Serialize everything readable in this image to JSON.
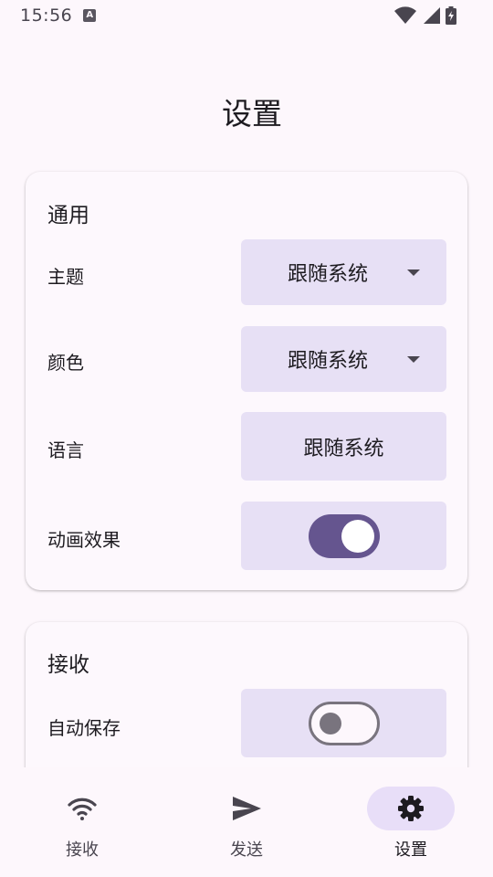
{
  "status_bar": {
    "time": "15:56",
    "notification_icon": "a-badge-icon",
    "icons": [
      "wifi-icon",
      "cellular-signal-icon",
      "battery-charging-icon"
    ]
  },
  "page": {
    "title": "设置"
  },
  "general": {
    "title": "通用",
    "theme": {
      "label": "主题",
      "value": "跟随系统"
    },
    "color": {
      "label": "颜色",
      "value": "跟随系统"
    },
    "language": {
      "label": "语言",
      "value": "跟随系统"
    },
    "animation": {
      "label": "动画效果",
      "enabled": true
    }
  },
  "receive": {
    "title": "接收",
    "auto_save": {
      "label": "自动保存",
      "enabled": false
    }
  },
  "bottom_nav": {
    "items": [
      {
        "label": "接收",
        "icon": "wifi-icon",
        "active": false
      },
      {
        "label": "发送",
        "icon": "send-icon",
        "active": false
      },
      {
        "label": "设置",
        "icon": "gear-icon",
        "active": true
      }
    ]
  },
  "colors": {
    "background": "#fdf7fc",
    "control": "#e7e0f5",
    "accent": "#65558f",
    "nav_active": "#e8def8"
  }
}
